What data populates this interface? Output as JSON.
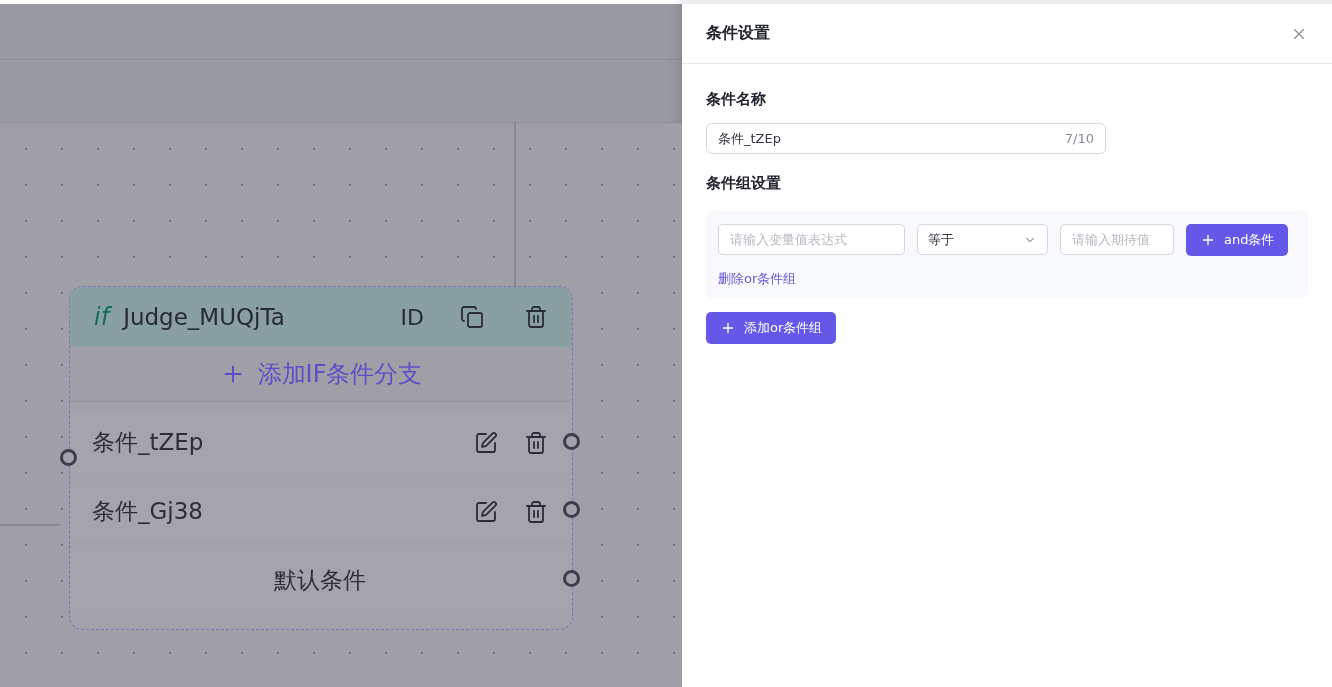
{
  "node": {
    "badge": "if",
    "title": "Judge_MUQjTa",
    "id_label": "ID",
    "add_branch": "添加IF条件分支",
    "conditions": [
      {
        "kind": "branch",
        "label": "条件_tZEp"
      },
      {
        "kind": "branch",
        "label": "条件_Gj38"
      },
      {
        "kind": "default",
        "label": "默认条件"
      }
    ]
  },
  "drawer": {
    "title": "条件设置",
    "name_label": "条件名称",
    "name_value": "条件_tZEp",
    "name_count": "7/10",
    "group_label": "条件组设置",
    "groups": [
      {
        "expression_placeholder": "请输入变量值表达式",
        "operator": "等于",
        "expected_placeholder": "请输入期待值",
        "and_button": "and条件",
        "delete_link": "删除or条件组"
      }
    ],
    "add_group_button": "添加or条件组"
  }
}
